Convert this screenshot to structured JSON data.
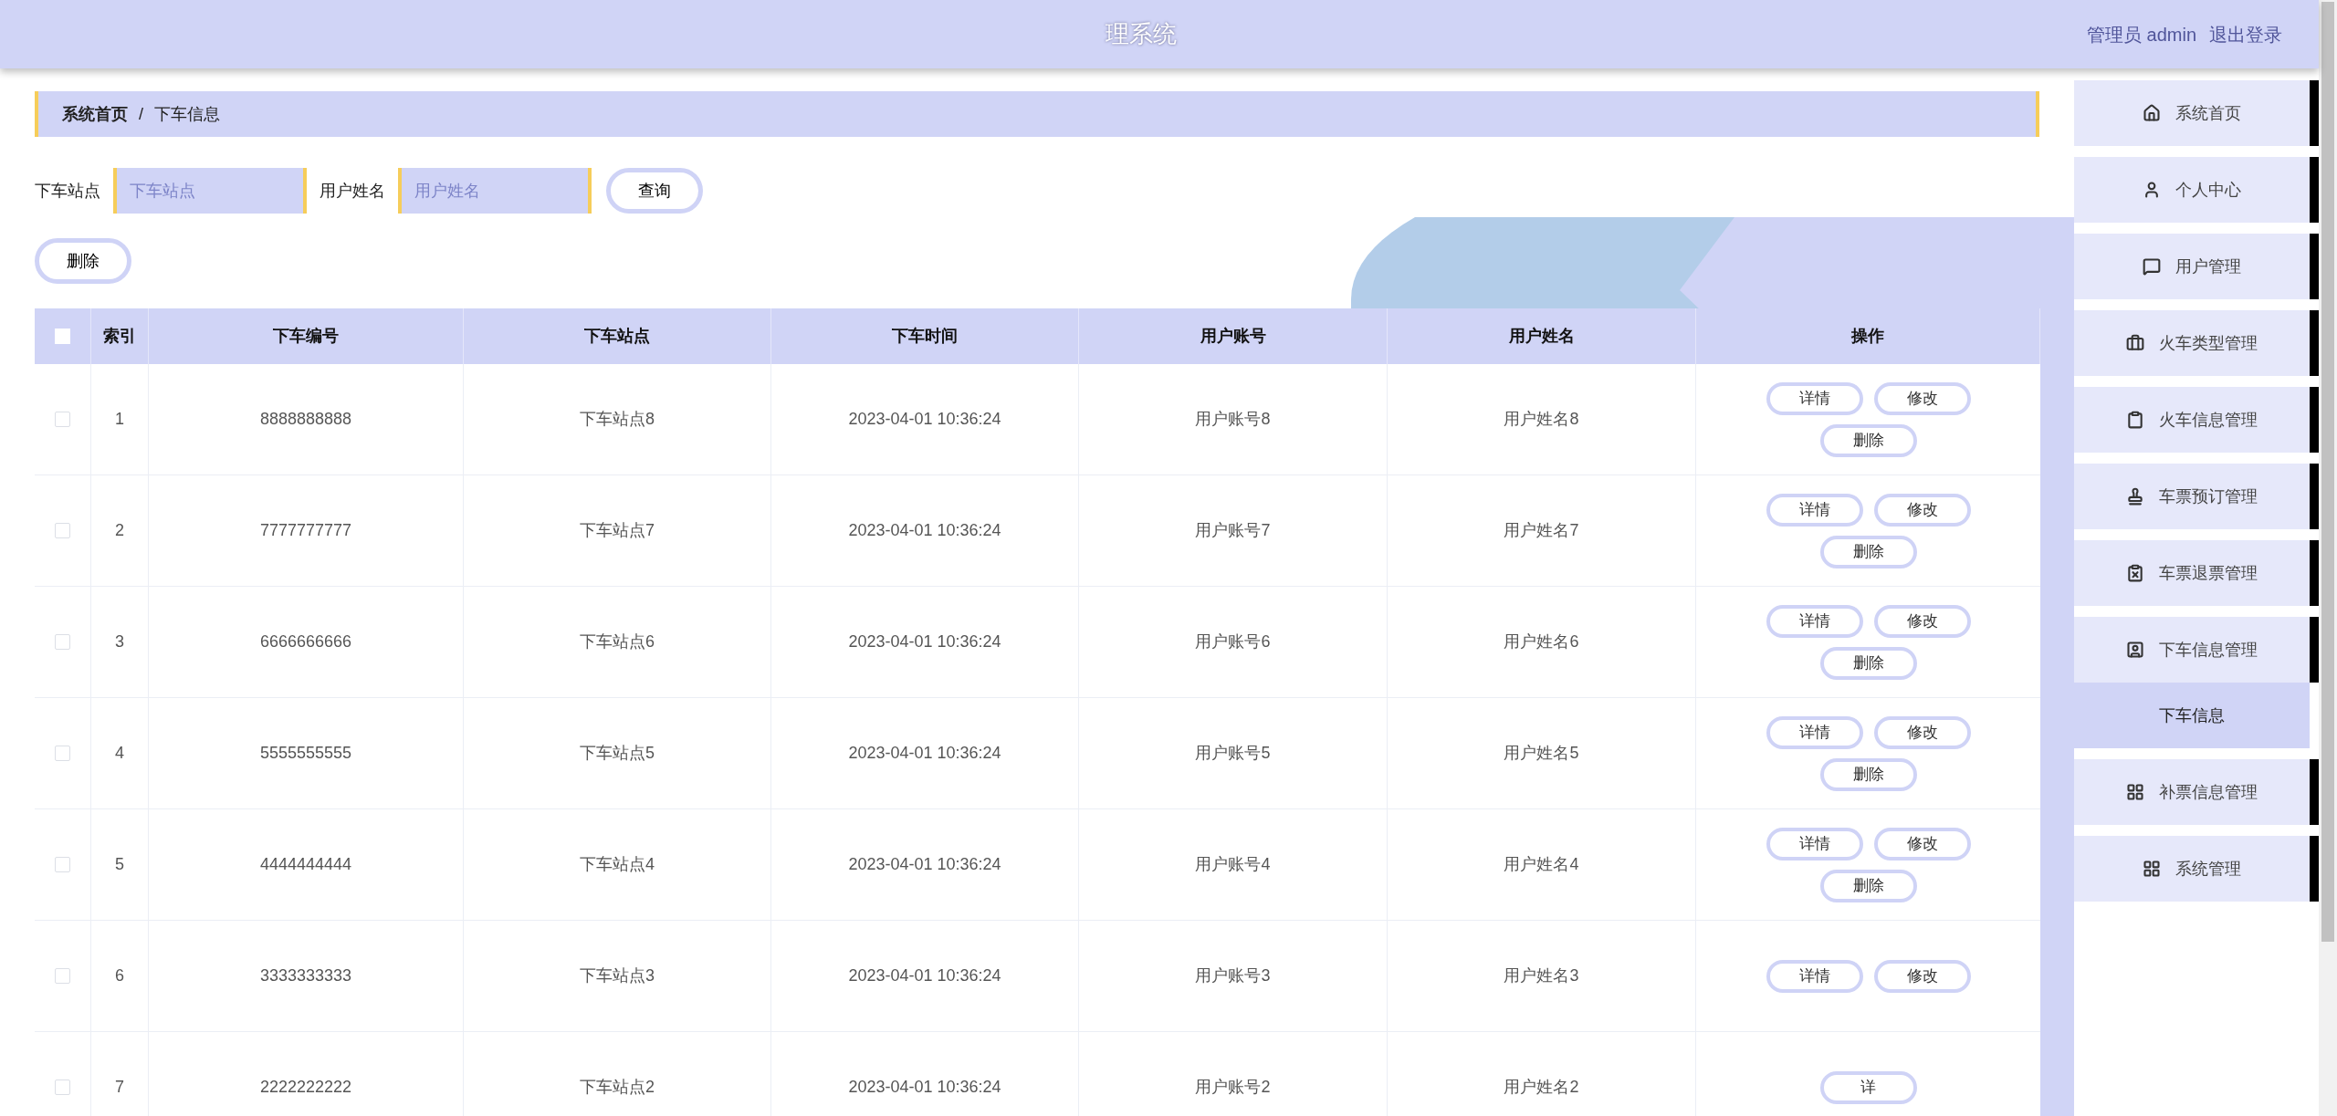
{
  "header": {
    "title": "理系统",
    "user_label": "管理员 admin",
    "logout": "退出登录"
  },
  "breadcrumb": {
    "separator": "/",
    "items": [
      {
        "label": "系统首页",
        "current": false
      },
      {
        "label": "下车信息",
        "current": true
      }
    ]
  },
  "search": {
    "fields": [
      {
        "label": "下车站点",
        "placeholder": "下车站点"
      },
      {
        "label": "用户姓名",
        "placeholder": "用户姓名"
      }
    ],
    "button": "查询"
  },
  "delete_button": "删除",
  "table": {
    "select_all_checked": false,
    "columns": [
      "索引",
      "下车编号",
      "下车站点",
      "下车时间",
      "用户账号",
      "用户姓名",
      "操作"
    ],
    "rows": [
      {
        "checked": false,
        "cells": [
          "1",
          "8888888888",
          "下车站点8",
          "2023-04-01 10:36:24",
          "用户账号8",
          "用户姓名8"
        ],
        "actions": [
          "详情",
          "修改",
          "删除"
        ]
      },
      {
        "checked": false,
        "cells": [
          "2",
          "7777777777",
          "下车站点7",
          "2023-04-01 10:36:24",
          "用户账号7",
          "用户姓名7"
        ],
        "actions": [
          "详情",
          "修改",
          "删除"
        ]
      },
      {
        "checked": false,
        "cells": [
          "3",
          "6666666666",
          "下车站点6",
          "2023-04-01 10:36:24",
          "用户账号6",
          "用户姓名6"
        ],
        "actions": [
          "详情",
          "修改",
          "删除"
        ]
      },
      {
        "checked": false,
        "cells": [
          "4",
          "5555555555",
          "下车站点5",
          "2023-04-01 10:36:24",
          "用户账号5",
          "用户姓名5"
        ],
        "actions": [
          "详情",
          "修改",
          "删除"
        ]
      },
      {
        "checked": false,
        "cells": [
          "5",
          "4444444444",
          "下车站点4",
          "2023-04-01 10:36:24",
          "用户账号4",
          "用户姓名4"
        ],
        "actions": [
          "详情",
          "修改",
          "删除"
        ]
      },
      {
        "checked": false,
        "cells": [
          "6",
          "3333333333",
          "下车站点3",
          "2023-04-01 10:36:24",
          "用户账号3",
          "用户姓名3"
        ],
        "actions": [
          "详情",
          "修改"
        ]
      },
      {
        "checked": false,
        "cells": [
          "7",
          "2222222222",
          "下车站点2",
          "2023-04-01 10:36:24",
          "用户账号2",
          "用户姓名2"
        ],
        "actions": [
          "详"
        ]
      }
    ]
  },
  "sidebar": {
    "items": [
      {
        "label": "系统首页",
        "selected": false
      },
      {
        "label": "个人中心",
        "selected": false
      },
      {
        "label": "用户管理",
        "selected": false
      },
      {
        "label": "火车类型管理",
        "selected": false
      },
      {
        "label": "火车信息管理",
        "selected": false
      },
      {
        "label": "车票预订管理",
        "selected": false
      },
      {
        "label": "车票退票管理",
        "selected": false
      },
      {
        "label": "下车信息管理",
        "selected": false,
        "children": [
          {
            "label": "下车信息",
            "selected": true
          }
        ]
      },
      {
        "label": "补票信息管理",
        "selected": false
      },
      {
        "label": "系统管理",
        "selected": false
      }
    ]
  }
}
